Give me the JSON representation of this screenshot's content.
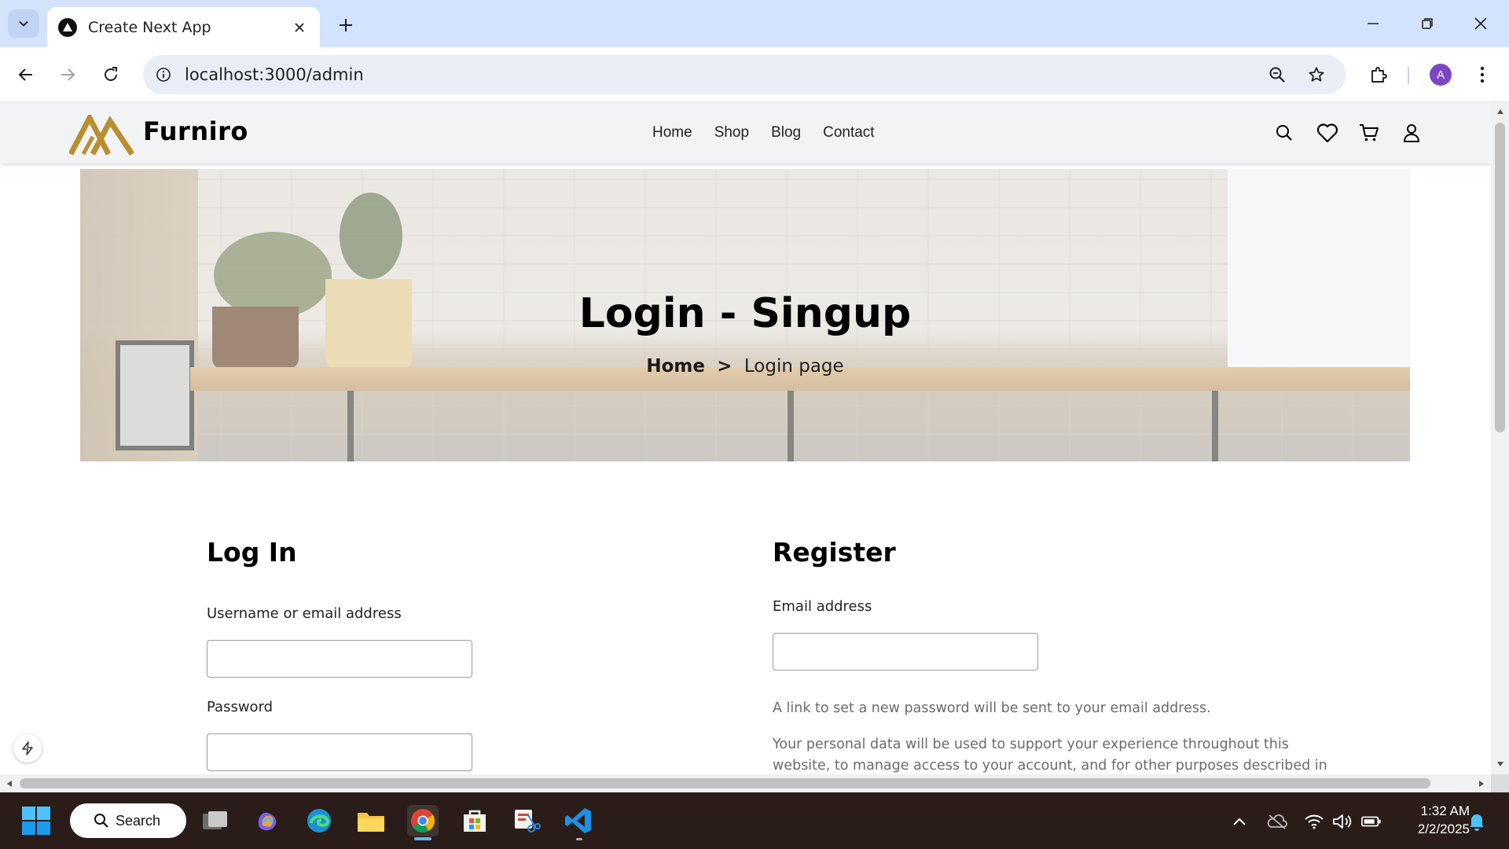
{
  "browser": {
    "tab_title": "Create Next App",
    "url": "localhost:3000/admin",
    "profile_initial": "A"
  },
  "site": {
    "brand": "Furniro",
    "brand_color": "#b88e2f",
    "nav": [
      "Home",
      "Shop",
      "Blog",
      "Contact"
    ]
  },
  "hero": {
    "title": "Login - Singup",
    "breadcrumb_home": "Home",
    "breadcrumb_sep": ">",
    "breadcrumb_current": "Login page"
  },
  "login": {
    "title": "Log In",
    "username_label": "Username or email address",
    "password_label": "Password"
  },
  "register": {
    "title": "Register",
    "email_label": "Email address",
    "info_text": "A link to set a new password will be sent to your email address.",
    "privacy_line1": "Your personal data will be used to support your experience throughout this",
    "privacy_line2": "website, to manage access to your account, and for other purposes described in"
  },
  "taskbar": {
    "search_label": "Search",
    "time": "1:32 AM",
    "date": "2/2/2025"
  }
}
